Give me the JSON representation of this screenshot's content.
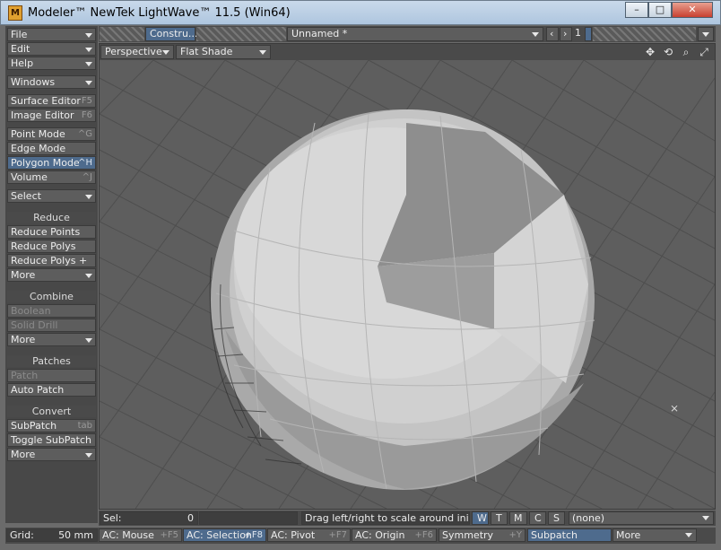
{
  "window": {
    "title": "Modeler™ NewTek LightWave™ 11.5 (Win64)",
    "app_icon": "M"
  },
  "left_panel": {
    "menus": [
      {
        "label": "File"
      },
      {
        "label": "Edit"
      },
      {
        "label": "Help"
      },
      {
        "label": "Windows"
      }
    ],
    "editors": [
      {
        "label": "Surface Editor",
        "shortcut": "F5"
      },
      {
        "label": "Image Editor",
        "shortcut": "F6"
      }
    ],
    "modes": [
      {
        "label": "Point Mode",
        "shortcut": "^G"
      },
      {
        "label": "Edge Mode",
        "shortcut": ""
      },
      {
        "label": "Polygon Mode",
        "shortcut": "^H"
      },
      {
        "label": "Volume",
        "shortcut": "^J"
      }
    ],
    "select_label": "Select",
    "reduce": {
      "header": "Reduce",
      "items": [
        "Reduce Points",
        "Reduce Polys",
        "Reduce Polys +"
      ],
      "more": "More"
    },
    "combine": {
      "header": "Combine",
      "items": [
        "Boolean",
        "Solid Drill"
      ],
      "more": "More"
    },
    "patches": {
      "header": "Patches",
      "items": [
        "Patch",
        "Auto Patch"
      ]
    },
    "convert": {
      "header": "Convert",
      "items": [
        {
          "label": "SubPatch",
          "shortcut": "tab"
        },
        {
          "label": "Toggle SubPatch",
          "shortcut": ""
        }
      ],
      "more": "More"
    }
  },
  "toolbar": {
    "tab_label": "Constru...",
    "object_name": "Unnamed *",
    "layer_number": "1"
  },
  "viewport": {
    "view": "Perspective",
    "shading": "Flat Shade"
  },
  "status": {
    "sel_label": "Sel:",
    "sel_count": "0",
    "message": "Drag left/right to scale around initial p...",
    "wtmcs": [
      "W",
      "T",
      "M",
      "C",
      "S"
    ],
    "none_label": "(none)"
  },
  "bottom": {
    "grid_label": "Grid:",
    "grid_value": "50 mm",
    "items": [
      {
        "label": "AC: Mouse",
        "shortcut": "+F5"
      },
      {
        "label": "AC: Selection",
        "shortcut": "+F8"
      },
      {
        "label": "AC: Pivot",
        "shortcut": "+F7"
      },
      {
        "label": "AC: Origin",
        "shortcut": "+F6"
      },
      {
        "label": "Symmetry",
        "shortcut": "+Y"
      },
      {
        "label": "Subpatch",
        "shortcut": ""
      },
      {
        "label": "More",
        "shortcut": ""
      }
    ]
  },
  "colors": {
    "accent": "#4e6b8d",
    "panel": "#484848",
    "button": "#5d5d5d",
    "viewport": "#5e5e5e"
  }
}
